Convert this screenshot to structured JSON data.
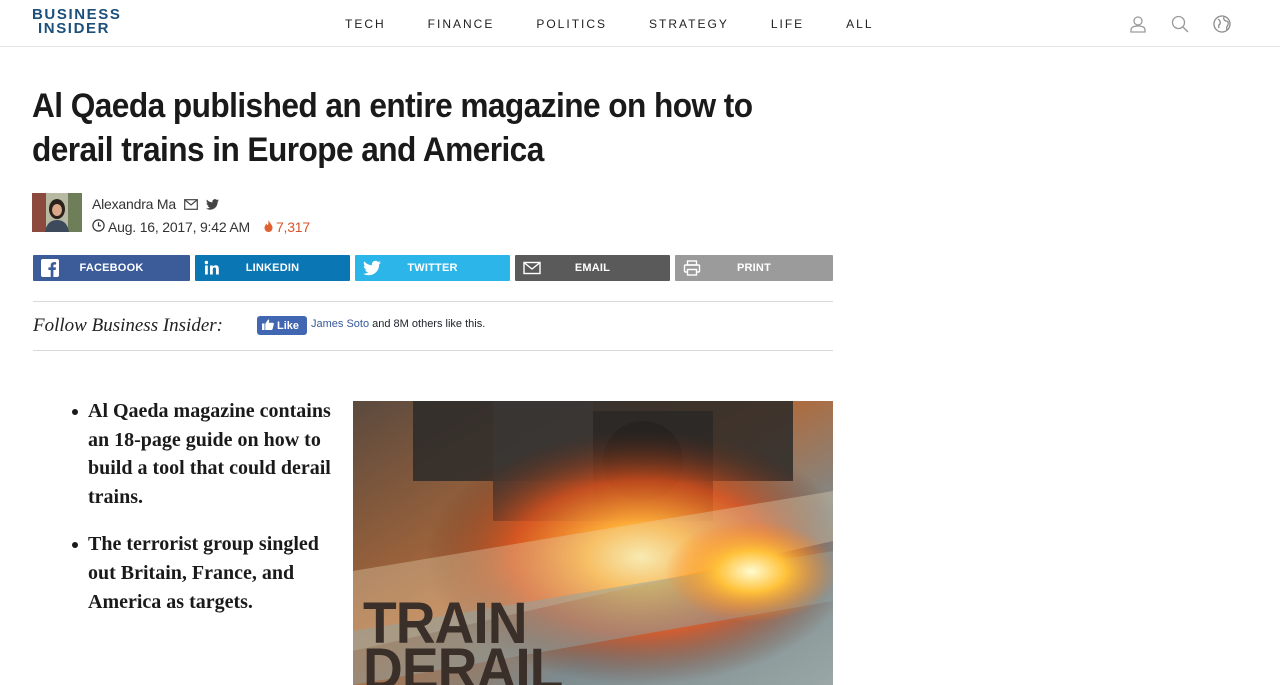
{
  "header": {
    "logo_line1": "BUSINESS",
    "logo_line2": "INSIDER",
    "nav": [
      "TECH",
      "FINANCE",
      "POLITICS",
      "STRATEGY",
      "LIFE",
      "ALL"
    ],
    "icons": [
      "user-icon",
      "search-icon",
      "globe-icon"
    ]
  },
  "article": {
    "headline": "Al Qaeda published an entire magazine on how to derail trains in Europe and America",
    "author": "Alexandra Ma",
    "date": "Aug. 16, 2017, 9:42 AM",
    "views": "7,317",
    "bullets": [
      "Al Qaeda magazine contains an 18-page guide on how to build a tool that could derail trains.",
      "The terrorist group singled out Britain, France, and America as targets."
    ],
    "image_text_line1": "TRAIN",
    "image_text_line2": "DERAIL"
  },
  "share": {
    "facebook": "FACEBOOK",
    "linkedin": "LINKEDIN",
    "twitter": "TWITTER",
    "email": "EMAIL",
    "print": "PRINT"
  },
  "follow": {
    "label": "Follow Business Insider:",
    "like_button": "Like",
    "like_name": "James Soto",
    "like_rest": " and 8M others like this."
  },
  "colors": {
    "brand": "#1c4f7a",
    "facebook": "#3b5b99",
    "linkedin": "#0a76b3",
    "twitter": "#2cb5e8",
    "email": "#5a5a5a",
    "print": "#9b9b9b",
    "views": "#d9542b"
  }
}
